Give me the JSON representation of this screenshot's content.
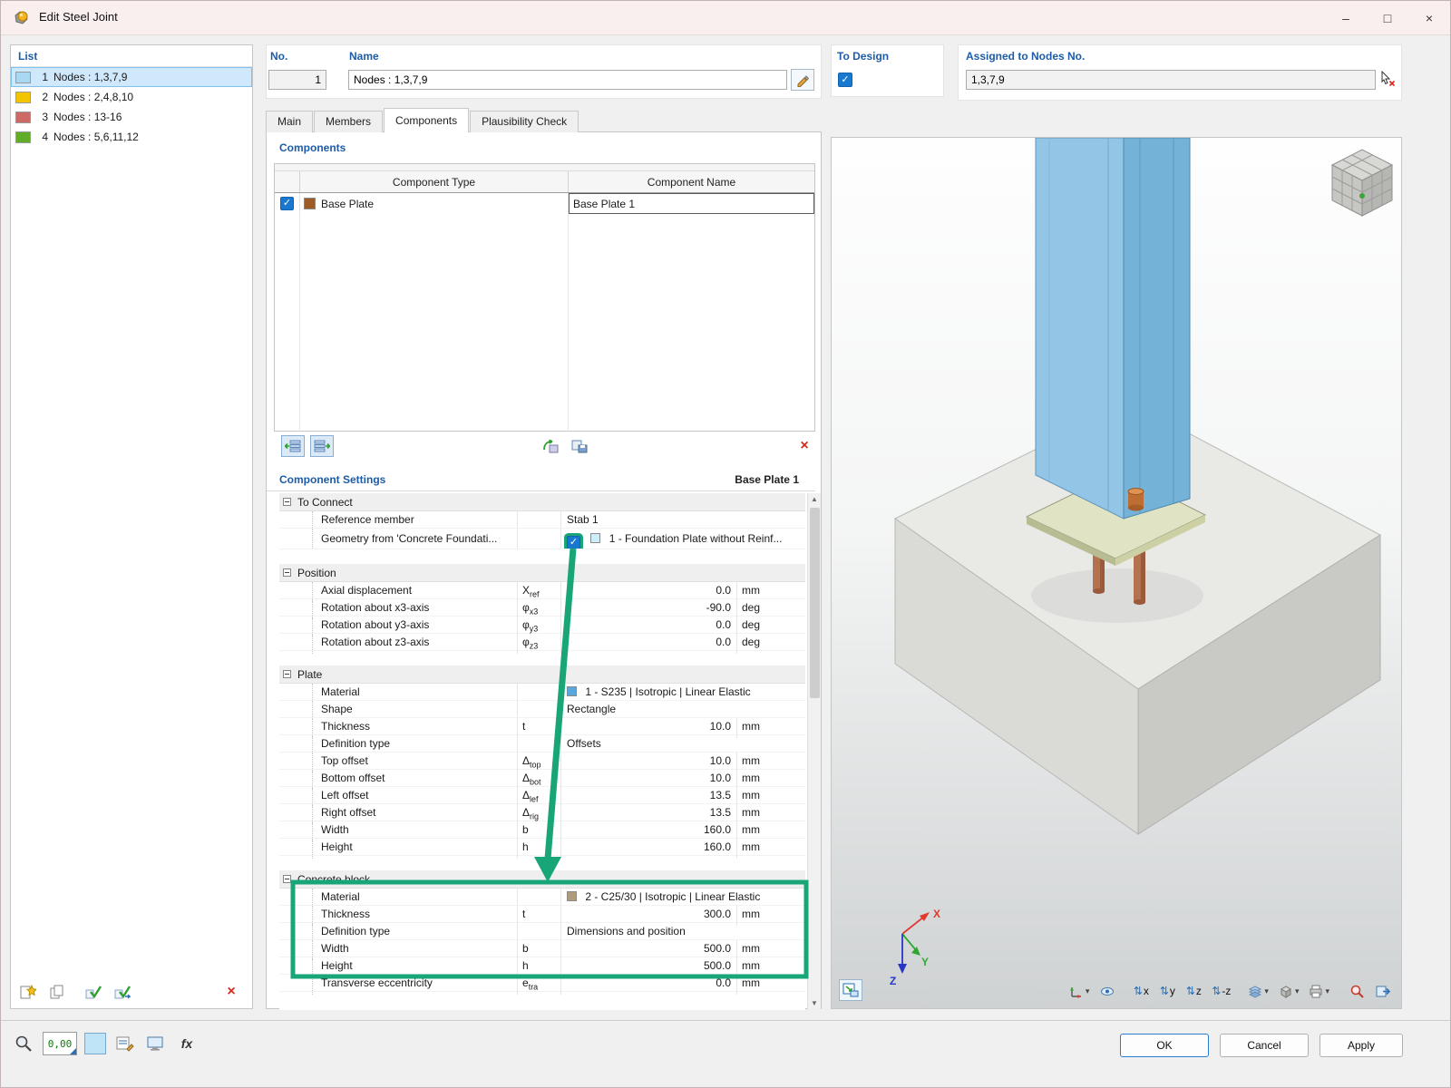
{
  "window": {
    "title": "Edit Steel Joint"
  },
  "icons": {
    "check": "✓",
    "minimize": "–",
    "maximize": "□",
    "close": "×",
    "caret": "▾",
    "updown_arrow": "⇅",
    "delete_x": "×",
    "scroll_up": "▲",
    "scroll_down": "▼"
  },
  "list_panel": {
    "header": "List",
    "items": [
      {
        "num": "1",
        "label": "Nodes : 1,3,7,9",
        "color": "#a9d9f2"
      },
      {
        "num": "2",
        "label": "Nodes : 2,4,8,10",
        "color": "#f3c400"
      },
      {
        "num": "3",
        "label": "Nodes : 13-16",
        "color": "#cd6a65"
      },
      {
        "num": "4",
        "label": "Nodes : 5,6,11,12",
        "color": "#61ad27"
      }
    ]
  },
  "header_fields": {
    "no_label": "No.",
    "no_value": "1",
    "name_label": "Name",
    "name_value": "Nodes : 1,3,7,9",
    "to_design_label": "To Design",
    "assigned_label": "Assigned to Nodes No.",
    "assigned_value": "1,3,7,9"
  },
  "tabs": {
    "main": "Main",
    "members": "Members",
    "components": "Components",
    "plausibility": "Plausibility Check"
  },
  "components_section": {
    "header": "Components",
    "col_type": "Component Type",
    "col_name": "Component Name",
    "row": {
      "type": "Base Plate",
      "name": "Base Plate 1",
      "swatch": "#9d5b28"
    }
  },
  "settings": {
    "header": "Component Settings",
    "component": "Base Plate 1",
    "rows": [
      {
        "label": "To Connect"
      },
      {
        "label": "Reference member",
        "value": "Stab 1"
      },
      {
        "label": "Geometry from 'Concrete Foundati...",
        "value": "1 - Foundation Plate without Reinf...",
        "swatch": "#cdeef8"
      },
      {
        "label": "Position"
      },
      {
        "label": "Axial displacement",
        "sym": "X",
        "sub": "ref",
        "value": "0.0",
        "unit": "mm"
      },
      {
        "label": "Rotation about x3-axis",
        "sym": "φ",
        "sub": "x3",
        "value": "-90.0",
        "unit": "deg"
      },
      {
        "label": "Rotation about y3-axis",
        "sym": "φ",
        "sub": "y3",
        "value": "0.0",
        "unit": "deg"
      },
      {
        "label": "Rotation about z3-axis",
        "sym": "φ",
        "sub": "z3",
        "value": "0.0",
        "unit": "deg"
      },
      {
        "label": "Plate"
      },
      {
        "label": "Material",
        "swatch": "#59a7dd",
        "value": "1 - S235 | Isotropic | Linear Elastic"
      },
      {
        "label": "Shape",
        "value": "Rectangle"
      },
      {
        "label": "Thickness",
        "sym": "t",
        "sub": "",
        "value": "10.0",
        "unit": "mm"
      },
      {
        "label": "Definition type",
        "value": "Offsets"
      },
      {
        "label": "Top offset",
        "sym": "Δ",
        "sub": "top",
        "value": "10.0",
        "unit": "mm"
      },
      {
        "label": "Bottom offset",
        "sym": "Δ",
        "sub": "bot",
        "value": "10.0",
        "unit": "mm"
      },
      {
        "label": "Left offset",
        "sym": "Δ",
        "sub": "lef",
        "value": "13.5",
        "unit": "mm"
      },
      {
        "label": "Right offset",
        "sym": "Δ",
        "sub": "rig",
        "value": "13.5",
        "unit": "mm"
      },
      {
        "label": "Width",
        "sym": "b",
        "sub": "",
        "value": "160.0",
        "unit": "mm"
      },
      {
        "label": "Height",
        "sym": "h",
        "sub": "",
        "value": "160.0",
        "unit": "mm"
      },
      {
        "label": "Concrete block"
      },
      {
        "label": "Material",
        "swatch": "#af9a7d",
        "value": "2 - C25/30 | Isotropic | Linear Elastic"
      },
      {
        "label": "Thickness",
        "sym": "t",
        "sub": "",
        "value": "300.0",
        "unit": "mm"
      },
      {
        "label": "Definition type",
        "value": "Dimensions and position"
      },
      {
        "label": "Width",
        "sym": "b",
        "sub": "",
        "value": "500.0",
        "unit": "mm"
      },
      {
        "label": "Height",
        "sym": "h",
        "sub": "",
        "value": "500.0",
        "unit": "mm"
      },
      {
        "label": "Transverse eccentricity",
        "sym": "e",
        "sub": "tra",
        "value": "0.0",
        "unit": "mm"
      }
    ]
  },
  "viewport": {
    "axes": {
      "x": "X",
      "y": "Y",
      "z": "Z"
    },
    "toolbar": {
      "view_x": "x",
      "view_y": "y",
      "view_z": "z",
      "view_mz": "-z"
    }
  },
  "statusbar": {
    "snap_value": "0,00",
    "fx_label": "fx"
  },
  "buttons": {
    "ok": "OK",
    "cancel": "Cancel",
    "apply": "Apply"
  },
  "annotation_color": "#18a678"
}
